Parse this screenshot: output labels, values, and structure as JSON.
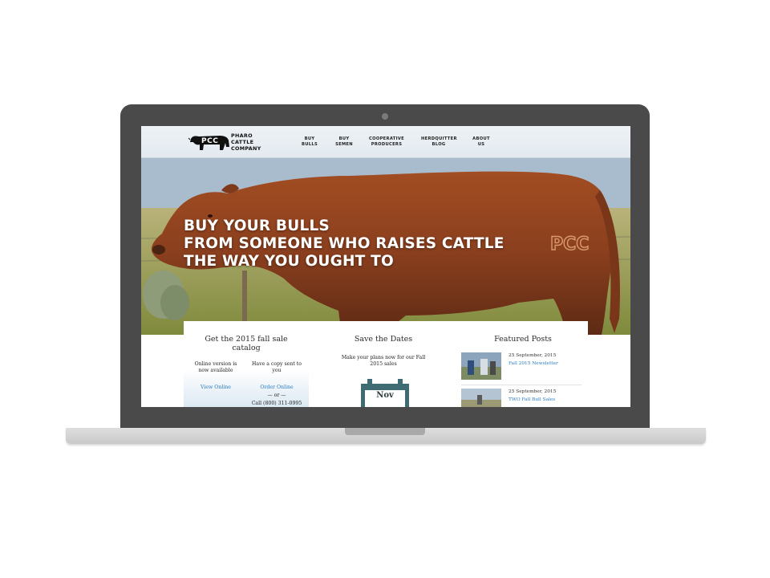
{
  "site": {
    "logo": {
      "initials": "PCC",
      "lines": [
        "PHARO",
        "CATTLE",
        "COMPANY"
      ]
    },
    "nav": [
      {
        "line1": "BUY",
        "line2": "BULLS"
      },
      {
        "line1": "BUY",
        "line2": "SEMEN"
      },
      {
        "line1": "COOPERATIVE",
        "line2": "PRODUCERS"
      },
      {
        "line1": "HERDQUITTER",
        "line2": "BLOG"
      },
      {
        "line1": "ABOUT",
        "line2": "US"
      }
    ],
    "hero": {
      "lines": [
        "BUY YOUR BULLS",
        "FROM SOMEONE WHO RAISES CATTLE",
        "THE WAY YOU OUGHT TO"
      ],
      "brand_mark": "PCC"
    },
    "catalog": {
      "title": "Get the 2015 fall sale catalog",
      "online_text": "Online version is now available",
      "mail_text": "Have a copy sent to you",
      "view_online": "View Online",
      "order_online": "Order Online",
      "or_text": "— or —",
      "call_text": "Call (800) 311-0995"
    },
    "dates": {
      "title": "Save the Dates",
      "text": "Make your plans now for our Fall 2015 sales",
      "calendar_month": "Nov"
    },
    "posts": {
      "title": "Featured Posts",
      "items": [
        {
          "date": "25 September, 2015",
          "link": "Fall 2015 Newsletter"
        },
        {
          "date": "25 September, 2015",
          "link": "TWO Fall Bull Sales"
        }
      ]
    }
  },
  "colors": {
    "link": "#2a7bbf",
    "calendar": "#3f6b73",
    "laptop_frame": "#4a4a4b",
    "bull": "#8a3f1e"
  }
}
